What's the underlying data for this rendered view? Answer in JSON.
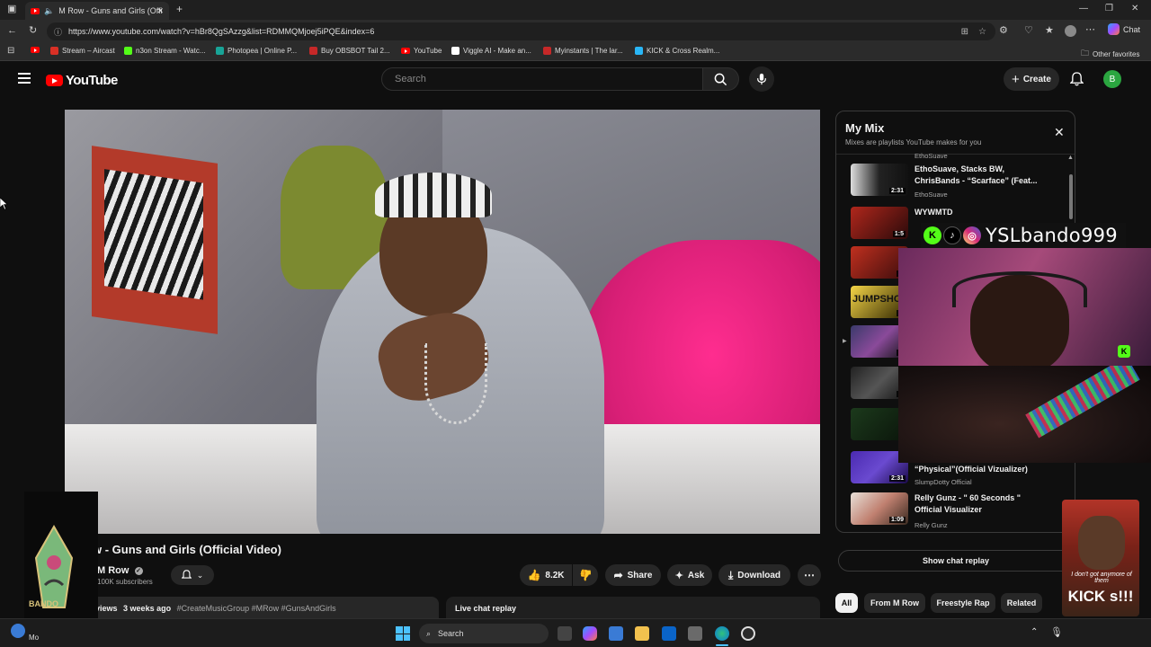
{
  "browser": {
    "tab_title": "M Row - Guns and Girls (Offi",
    "new_tab_symbol": "+",
    "url": "https://www.youtube.com/watch?v=hBr8QgSAzzg&list=RDMMQMjoej5iPQE&index=6",
    "chat_label": "Chat",
    "window_controls": [
      "—",
      "❐",
      "✕"
    ],
    "bookmarks": [
      {
        "label": "Stream – Aircast",
        "color": "#d93025"
      },
      {
        "label": "n3on Stream - Watc...",
        "color": "#53fc18"
      },
      {
        "label": "Photopea | Online P...",
        "color": "#18a497"
      },
      {
        "label": "Buy OBSBOT Tail 2...",
        "color": "#c62828"
      },
      {
        "label": "YouTube",
        "color": "#ff0000"
      },
      {
        "label": "Viggle AI - Make an...",
        "color": "#ffffff"
      },
      {
        "label": "Myinstants | The lar...",
        "color": "#c62828"
      },
      {
        "label": "KICK & Cross Realm...",
        "color": "#29b6f6"
      }
    ],
    "other_favorites": "Other favorites"
  },
  "youtube": {
    "logo_text": "YouTube",
    "search_placeholder": "Search",
    "create_label": "Create",
    "avatar_letter": "B"
  },
  "video": {
    "title": "w - Guns and Girls (Official Video)",
    "channel": "M Row",
    "subscribers": "100K subscribers",
    "likes": "8.2K",
    "share": "Share",
    "ask": "Ask",
    "download": "Download",
    "description_views": "views",
    "description_age": "3 weeks ago",
    "description_tags": "#CreateMusicGroup #MRow #GunsAndGirls",
    "live_chat_replay": "Live chat replay"
  },
  "playlist": {
    "title": "My Mix",
    "subtitle": "Mixes are playlists YouTube makes for you",
    "top_channel": "EthoSuave",
    "items": [
      {
        "title": "EthoSuave, Stacks BW, ChrisBands - “Scarface” (Feat...",
        "channel": "EthoSuave",
        "duration": "2:31"
      },
      {
        "title": "WYWMTD",
        "channel": "",
        "duration": "1:5"
      },
      {
        "title": "",
        "channel": "",
        "duration": "2:"
      },
      {
        "title": "",
        "channel": "",
        "duration": "2:"
      },
      {
        "title": "",
        "channel": "",
        "duration": "1:"
      },
      {
        "title": "",
        "channel": "",
        "duration": "2:"
      },
      {
        "title": "",
        "channel": "",
        "duration": ""
      },
      {
        "title": "“Physical”(Official Vizualizer)",
        "channel": "SlumpDotty Official",
        "duration": "2:31"
      },
      {
        "title": "Relly Gunz - \" 60 Seconds \" Official Visualizer",
        "channel": "Relly Gunz",
        "duration": "1:09"
      }
    ],
    "show_chat_replay": "Show chat replay"
  },
  "chips": [
    "All",
    "From M Row",
    "Freestyle Rap",
    "Related"
  ],
  "overlay": {
    "streamer_name": "YSLbando999",
    "poster_text": "JUMPSHO",
    "meme_caption": "I don't got anymore of them",
    "meme_big": "KICK s!!!",
    "logo_caption": "BANDO"
  },
  "taskbar": {
    "search_label": "Search",
    "tray_label": "Mo"
  }
}
